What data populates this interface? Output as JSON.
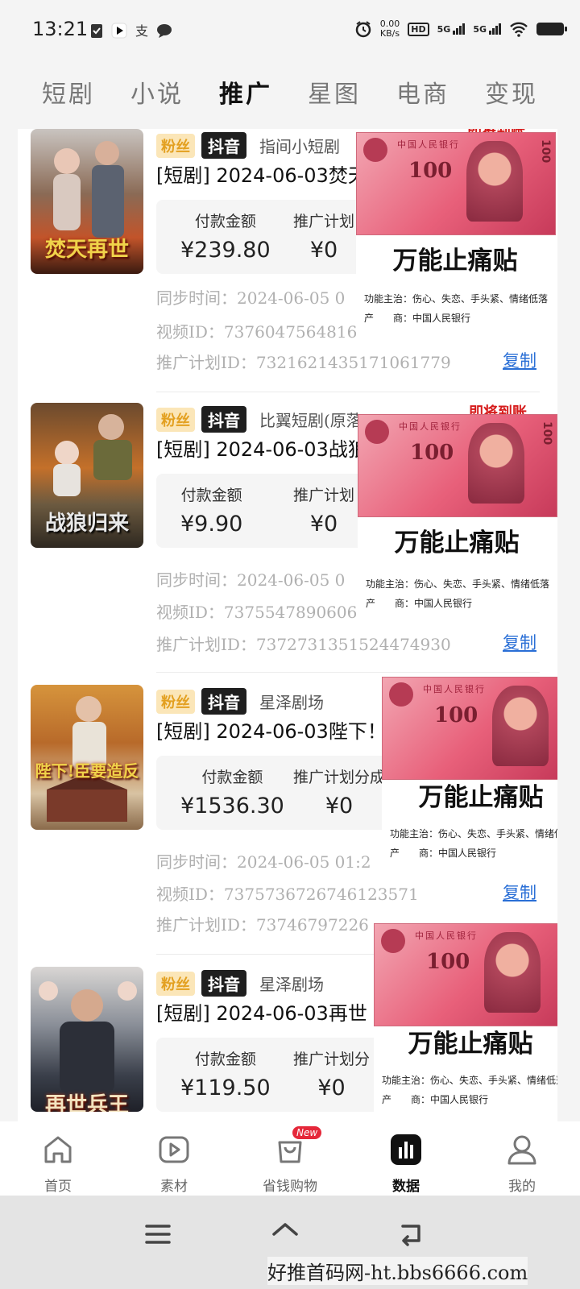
{
  "status": {
    "time": "13:21",
    "net_speed_value": "0.00",
    "net_speed_unit": "KB/s",
    "hd_label": "HD",
    "sim1": "5G",
    "sim2": "5G"
  },
  "tabs": [
    {
      "label": "短剧"
    },
    {
      "label": "小说"
    },
    {
      "label": "推广",
      "active": true
    },
    {
      "label": "星图"
    },
    {
      "label": "电商"
    },
    {
      "label": "变现"
    }
  ],
  "cards": [
    {
      "poster_title": "焚天再世",
      "tag_fans": "粉丝",
      "tag_platform": "抖音",
      "supplier": "指间小短剧",
      "title": "[短剧] 2024-06-03焚天",
      "pay_label": "付款金额",
      "pay_value": "¥239.80",
      "plan_label": "推广计划",
      "plan_value": "¥0",
      "sync": "同步时间：2024-06-05 0",
      "video_id": "视频ID：7376047564816",
      "plan_id": "推广计划ID：7321621435171061779",
      "copy": "复制"
    },
    {
      "poster_title": "战狼归来",
      "tag_fans": "粉丝",
      "tag_platform": "抖音",
      "supplier": "比翼短剧(原落雪)",
      "title": "[短剧] 2024-06-03战狼",
      "pay_label": "付款金额",
      "pay_value": "¥9.90",
      "plan_label": "推广计划",
      "plan_value": "¥0",
      "sync": "同步时间：2024-06-05 0",
      "video_id": "视频ID：7375547890606",
      "plan_id": "推广计划ID：7372731351524474930",
      "copy": "复制"
    },
    {
      "poster_title": "陛下!臣要造反",
      "tag_fans": "粉丝",
      "tag_platform": "抖音",
      "supplier": "星泽剧场",
      "title": "[短剧] 2024-06-03陛下！",
      "pay_label": "付款金额",
      "pay_value": "¥1536.30",
      "plan_label": "推广计划分成",
      "plan_value": "¥0",
      "sync": "同步时间：2024-06-05 01:2",
      "video_id": "视频ID：7375736726746123571",
      "plan_id": "推广计划ID：73746797226",
      "copy": "复制"
    },
    {
      "poster_title": "再世兵王",
      "tag_fans": "粉丝",
      "tag_platform": "抖音",
      "supplier": "星泽剧场",
      "title": "[短剧] 2024-06-03再世",
      "pay_label": "付款金额",
      "pay_value": "¥119.50",
      "plan_label": "推广计划分",
      "plan_value": "¥0"
    }
  ],
  "overlay": {
    "red_text": "即将到账",
    "note_header": "中国人民银行",
    "note_value": "100",
    "title": "万能止痛贴",
    "line1": "功能主治：伤心、失恋、手头紧、情绪低落",
    "line2": "产　　商：中国人民银行"
  },
  "bottom_nav": [
    {
      "label": "首页",
      "icon": "home-icon"
    },
    {
      "label": "素材",
      "icon": "play-icon"
    },
    {
      "label": "省钱购物",
      "icon": "shopping-bag-icon",
      "badge": "New"
    },
    {
      "label": "数据",
      "icon": "chart-icon",
      "active": true
    },
    {
      "label": "我的",
      "icon": "user-icon"
    }
  ],
  "watermark": "好推首码网-ht.bbs6666.com"
}
